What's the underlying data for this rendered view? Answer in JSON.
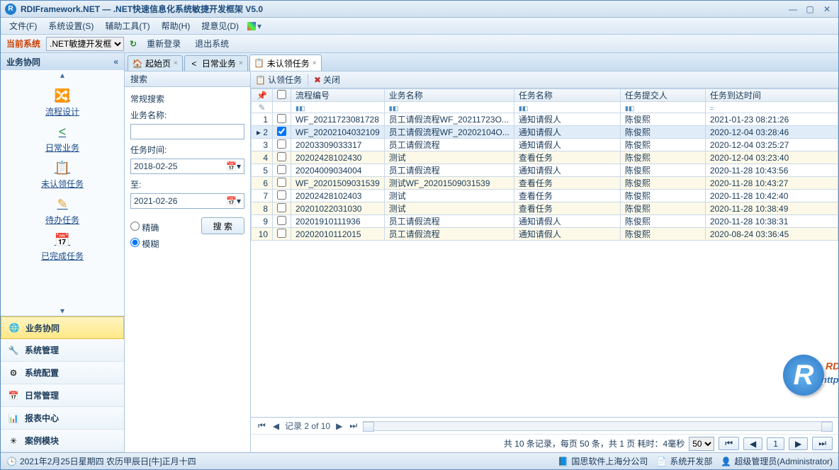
{
  "title": "RDIFramework.NET — .NET快速信息化系统敏捷开发框架 V5.0",
  "menu": {
    "file": "文件(F)",
    "settings": "系统设置(S)",
    "tools": "辅助工具(T)",
    "help": "帮助(H)",
    "feedback": "提意见(D)"
  },
  "toolbar": {
    "current": "当前系统",
    "selected": ".NET敏捷开发框架",
    "relogin": "重新登录",
    "exit": "退出系统"
  },
  "side": {
    "title": "业务协同",
    "items": [
      {
        "label": "流程设计",
        "ico": "🔀",
        "col": "#2a8a2a"
      },
      {
        "label": "日常业务",
        "ico": "<",
        "col": "#2a9a4a"
      },
      {
        "label": "未认领任务",
        "ico": "📋",
        "col": "#e0a030"
      },
      {
        "label": "待办任务",
        "ico": "✎",
        "col": "#e0a030"
      },
      {
        "label": "已完成任务",
        "ico": "📅",
        "col": "#e0a030"
      }
    ],
    "nav": [
      {
        "label": "业务协同",
        "ico": "🌐",
        "active": true
      },
      {
        "label": "系统管理",
        "ico": "🔧"
      },
      {
        "label": "系统配置",
        "ico": "⚙"
      },
      {
        "label": "日常管理",
        "ico": "📅"
      },
      {
        "label": "报表中心",
        "ico": "📊"
      },
      {
        "label": "案例模块",
        "ico": "✳"
      }
    ]
  },
  "tabs": [
    {
      "label": "起始页",
      "ico": "🏠"
    },
    {
      "label": "日常业务",
      "ico": "<"
    },
    {
      "label": "未认领任务",
      "ico": "📋",
      "active": true
    }
  ],
  "search": {
    "tab": "搜索",
    "heading": "常规搜索",
    "bizLabel": "业务名称:",
    "bizValue": "",
    "timeLabel": "任务时间:",
    "from": "2018-02-25",
    "toLabel": "至:",
    "to": "2021-02-26",
    "exact": "精确",
    "fuzzy": "模糊",
    "button": "搜 索"
  },
  "gridToolbar": {
    "claim": "认领任务",
    "close": "关闭"
  },
  "columns": {
    "procNo": "流程编号",
    "bizName": "业务名称",
    "taskName": "任务名称",
    "submitter": "任务提交人",
    "arrive": "任务到达时间"
  },
  "rows": [
    {
      "n": "1",
      "procNo": "WF_20211723081728",
      "bizName": "员工请假流程WF_20211723O...",
      "taskName": "通知请假人",
      "submitter": "陈俊熙",
      "arrive": "2021-01-23 08:21:26"
    },
    {
      "n": "2",
      "procNo": "WF_20202104032109",
      "bizName": "员工请假流程WF_20202104O...",
      "taskName": "通知请假人",
      "submitter": "陈俊熙",
      "arrive": "2020-12-04 03:28:46",
      "sel": true,
      "chk": true
    },
    {
      "n": "3",
      "procNo": "20203309033317",
      "bizName": "员工请假流程",
      "taskName": "通知请假人",
      "submitter": "陈俊熙",
      "arrive": "2020-12-04 03:25:27"
    },
    {
      "n": "4",
      "procNo": "20202428102430",
      "bizName": "测试",
      "taskName": "查看任务",
      "submitter": "陈俊熙",
      "arrive": "2020-12-04 03:23:40"
    },
    {
      "n": "5",
      "procNo": "20204009034004",
      "bizName": "员工请假流程",
      "taskName": "通知请假人",
      "submitter": "陈俊熙",
      "arrive": "2020-11-28 10:43:56"
    },
    {
      "n": "6",
      "procNo": "WF_20201509031539",
      "bizName": "测试WF_20201509031539",
      "taskName": "查看任务",
      "submitter": "陈俊熙",
      "arrive": "2020-11-28 10:43:27"
    },
    {
      "n": "7",
      "procNo": "20202428102403",
      "bizName": "测试",
      "taskName": "查看任务",
      "submitter": "陈俊熙",
      "arrive": "2020-11-28 10:42:40"
    },
    {
      "n": "8",
      "procNo": "20201022031030",
      "bizName": "测试",
      "taskName": "查看任务",
      "submitter": "陈俊熙",
      "arrive": "2020-11-28 10:38:49"
    },
    {
      "n": "9",
      "procNo": "20201910111936",
      "bizName": "员工请假流程",
      "taskName": "通知请假人",
      "submitter": "陈俊熙",
      "arrive": "2020-11-28 10:38:31"
    },
    {
      "n": "10",
      "procNo": "20202010112015",
      "bizName": "员工请假流程",
      "taskName": "通知请假人",
      "submitter": "陈俊熙",
      "arrive": "2020-08-24 03:36:45"
    }
  ],
  "pager": {
    "label": "记录 2 of 10"
  },
  "paging": {
    "summary": "共 10 条记录，每页 50 条，共 1 页  耗时：4毫秒",
    "pageSize": "50",
    "page": "1"
  },
  "status": {
    "date": "2021年2月25日星期四 农历甲辰日[牛]正月十四",
    "company": "国思软件上海分公司",
    "dept": "系统开发部",
    "user": "超级管理员(Administrator)"
  },
  "watermark": {
    "t1": "RDIFramework.NET",
    "t2": "http://www.rdiframework.net"
  }
}
